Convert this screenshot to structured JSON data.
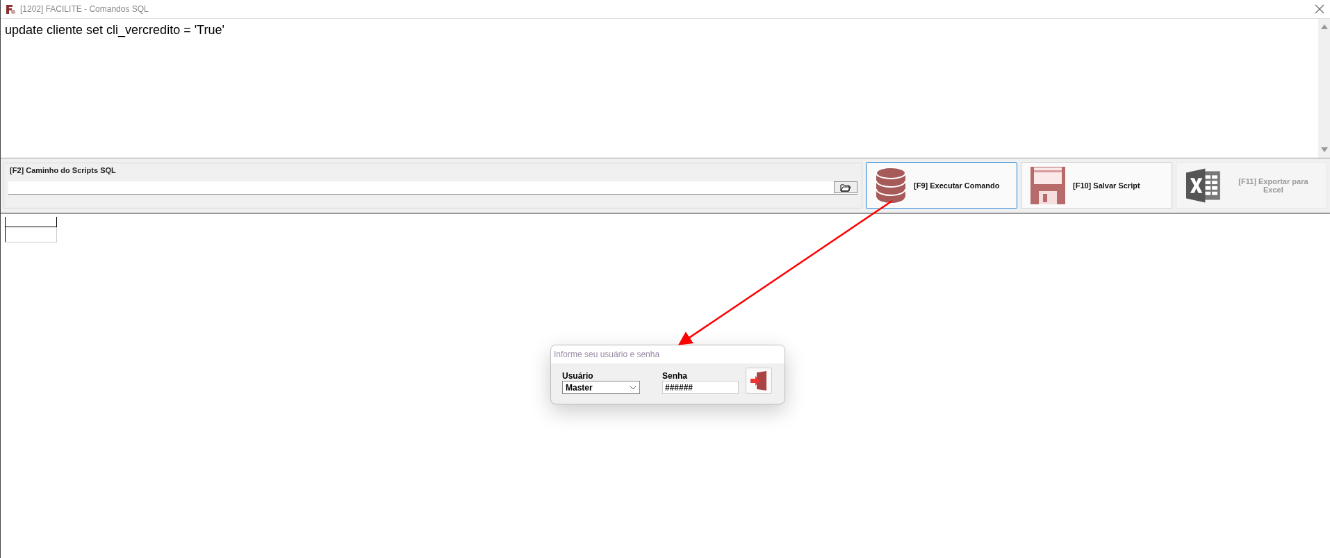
{
  "window": {
    "title": "[1202] FACILITE - Comandos SQL"
  },
  "editor": {
    "value": "update cliente set cli_vercredito = 'True'"
  },
  "path_group": {
    "label": "[F2] Caminho do Scripts SQL"
  },
  "buttons": [
    {
      "kind": "database",
      "label": "[F9] Executar Comando",
      "focused": true,
      "disabled": false
    },
    {
      "kind": "floppy",
      "label": "[F10] Salvar Script",
      "focused": false,
      "disabled": false
    },
    {
      "kind": "excel",
      "label": "[F11] Exportar para Excel",
      "focused": false,
      "disabled": true
    }
  ],
  "login_dialog": {
    "title": "Informe seu usuário e senha",
    "user_label": "Usuário",
    "user_value": "Master",
    "password_label": "Senha",
    "password_value": "######"
  }
}
